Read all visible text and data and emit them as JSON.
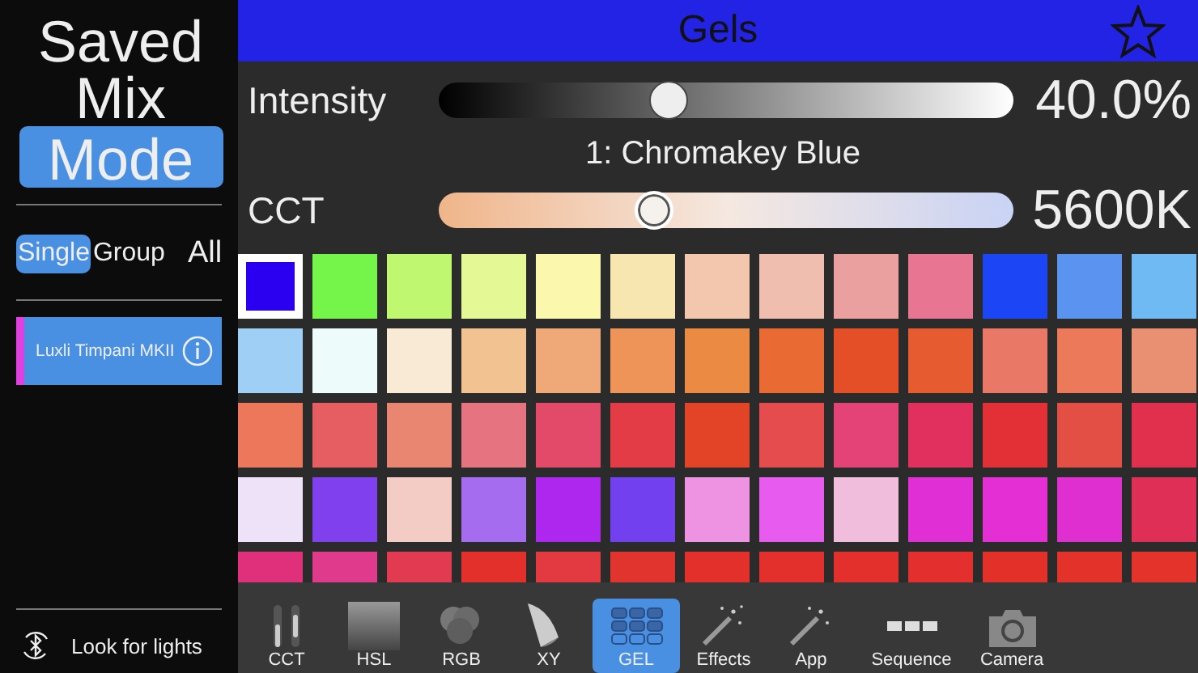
{
  "sidebar": {
    "modes": [
      {
        "label": "Saved",
        "selected": false
      },
      {
        "label": "Mix",
        "selected": false
      },
      {
        "label": "Mode",
        "selected": true
      }
    ],
    "scopes": [
      {
        "label": "Single",
        "selected": true
      },
      {
        "label": "Group",
        "selected": false
      },
      {
        "label": "All",
        "selected": false
      }
    ],
    "devices": [
      {
        "name": "Luxli Timpani MKII",
        "color": "#e040e0"
      }
    ],
    "scan_button": "Look for lights"
  },
  "header": {
    "title": "Gels",
    "favorite": false
  },
  "intensity": {
    "label": "Intensity",
    "level": 0.4,
    "reading": "40.0%"
  },
  "gel_name": "1: Chromakey Blue",
  "cct": {
    "label": "CCT",
    "level": 0.375,
    "reading": "5600K"
  },
  "gels": [
    {
      "color": "#2b00f0",
      "selected": true
    },
    {
      "color": "#75f54a",
      "selected": false
    },
    {
      "color": "#c0f770",
      "selected": false
    },
    {
      "color": "#e4f896",
      "selected": false
    },
    {
      "color": "#fbf8ae",
      "selected": false
    },
    {
      "color": "#f8e6b0",
      "selected": false
    },
    {
      "color": "#f3c6ae",
      "selected": false
    },
    {
      "color": "#efbeae",
      "selected": false
    },
    {
      "color": "#eba0a0",
      "selected": false
    },
    {
      "color": "#e87592",
      "selected": false
    },
    {
      "color": "#1c45f5",
      "selected": false
    },
    {
      "color": "#5b93f0",
      "selected": false
    },
    {
      "color": "#6fbaf2",
      "selected": false
    },
    {
      "color": "#a0cff5",
      "selected": false
    },
    {
      "color": "#eefbfb",
      "selected": false
    },
    {
      "color": "#f9ead6",
      "selected": false
    },
    {
      "color": "#f2c290",
      "selected": false
    },
    {
      "color": "#efa877",
      "selected": false
    },
    {
      "color": "#ee9458",
      "selected": false
    },
    {
      "color": "#eb8a42",
      "selected": false
    },
    {
      "color": "#e96a33",
      "selected": false
    },
    {
      "color": "#e54f27",
      "selected": false
    },
    {
      "color": "#e65b30",
      "selected": false
    },
    {
      "color": "#e97866",
      "selected": false
    },
    {
      "color": "#ec7a5a",
      "selected": false
    },
    {
      "color": "#ea9072",
      "selected": false
    },
    {
      "color": "#ec775a",
      "selected": false
    },
    {
      "color": "#e65e62",
      "selected": false
    },
    {
      "color": "#e98672",
      "selected": false
    },
    {
      "color": "#e67380",
      "selected": false
    },
    {
      "color": "#e34a6a",
      "selected": false
    },
    {
      "color": "#e43c47",
      "selected": false
    },
    {
      "color": "#e34327",
      "selected": false
    },
    {
      "color": "#e54c4e",
      "selected": false
    },
    {
      "color": "#e34376",
      "selected": false
    },
    {
      "color": "#e12f5e",
      "selected": false
    },
    {
      "color": "#e33036",
      "selected": false
    },
    {
      "color": "#e44f45",
      "selected": false
    },
    {
      "color": "#e12f4e",
      "selected": false
    },
    {
      "color": "#ede2f7",
      "selected": false
    },
    {
      "color": "#8040ee",
      "selected": false
    },
    {
      "color": "#f3cdc5",
      "selected": false
    },
    {
      "color": "#a56cf0",
      "selected": false
    },
    {
      "color": "#ae27ee",
      "selected": false
    },
    {
      "color": "#7240ee",
      "selected": false
    },
    {
      "color": "#ee93e2",
      "selected": false
    },
    {
      "color": "#e75cee",
      "selected": false
    },
    {
      "color": "#f0bddc",
      "selected": false
    },
    {
      "color": "#e02fd5",
      "selected": false
    },
    {
      "color": "#e42fd4",
      "selected": false
    },
    {
      "color": "#e02fd0",
      "selected": false
    },
    {
      "color": "#e02f56",
      "selected": false
    },
    {
      "color": "#e0307c",
      "selected": false
    },
    {
      "color": "#e03a8d",
      "selected": false
    },
    {
      "color": "#e23a50",
      "selected": false
    },
    {
      "color": "#e3302a",
      "selected": false
    },
    {
      "color": "#e23a40",
      "selected": false
    },
    {
      "color": "#e2342e",
      "selected": false
    },
    {
      "color": "#e3302b",
      "selected": false
    },
    {
      "color": "#e3302c",
      "selected": false
    },
    {
      "color": "#e3302d",
      "selected": false
    },
    {
      "color": "#e3302e",
      "selected": false
    },
    {
      "color": "#e3312a",
      "selected": false
    },
    {
      "color": "#e3322a",
      "selected": false
    },
    {
      "color": "#e3332a",
      "selected": false
    }
  ],
  "toolbar": [
    {
      "kind": "cct",
      "label": "CCT",
      "selected": false
    },
    {
      "kind": "hsl",
      "label": "HSL",
      "selected": false
    },
    {
      "kind": "rgb",
      "label": "RGB",
      "selected": false
    },
    {
      "kind": "xy",
      "label": "XY",
      "selected": false
    },
    {
      "kind": "gel",
      "label": "GEL",
      "selected": true
    },
    {
      "kind": "effects",
      "label": "Effects",
      "selected": false
    },
    {
      "kind": "app",
      "label": "App",
      "selected": false
    },
    {
      "kind": "sequence",
      "label": "Sequence",
      "selected": false
    },
    {
      "kind": "camera",
      "label": "Camera",
      "selected": false
    }
  ]
}
